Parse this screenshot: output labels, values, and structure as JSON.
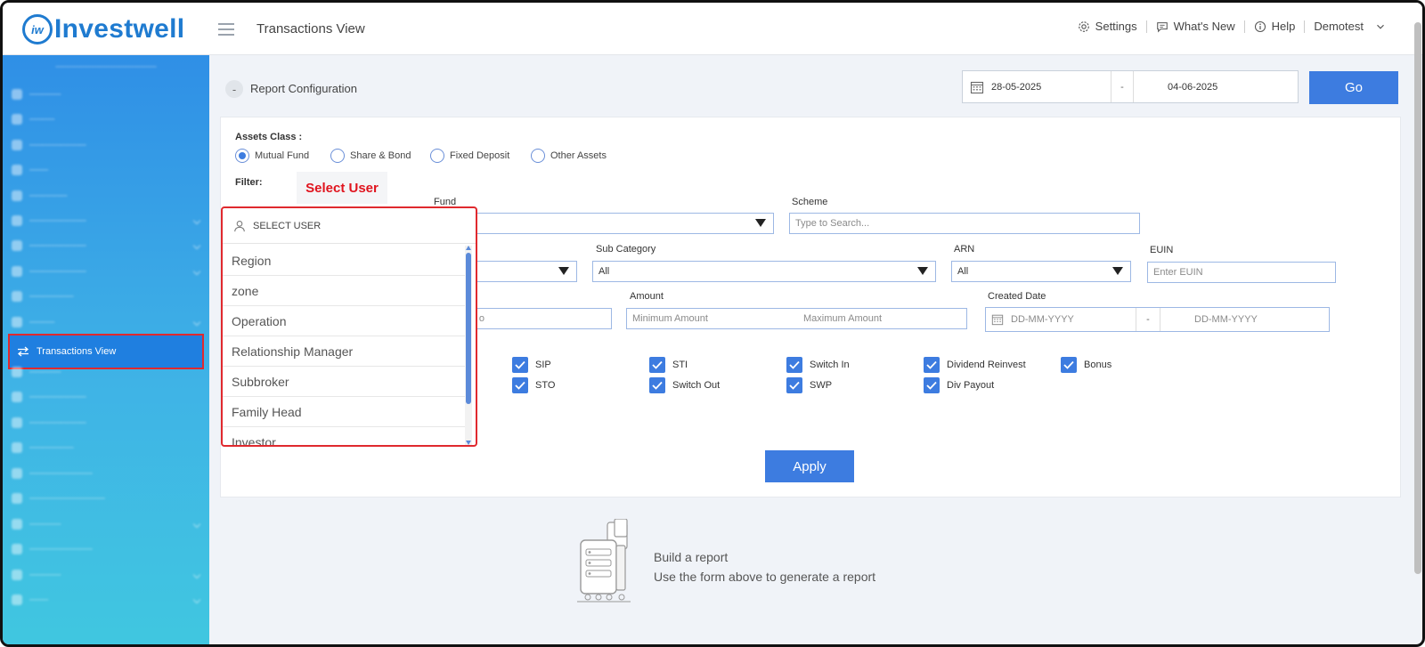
{
  "app": {
    "brand": "Investwell",
    "brand_icon": "iw",
    "page_title": "Transactions View"
  },
  "header": {
    "settings": "Settings",
    "whats_new": "What's New",
    "help": "Help",
    "user": "Demotest"
  },
  "sidebar": {
    "active_item": "Transactions View"
  },
  "report": {
    "config_toggle": "-",
    "config_label": "Report Configuration",
    "date_from": "28-05-2025",
    "date_sep": "-",
    "date_to": "04-06-2025",
    "go": "Go"
  },
  "form": {
    "assets_class_label": "Assets Class :",
    "assets": [
      "Mutual Fund",
      "Share & Bond",
      "Fixed Deposit",
      "Other Assets"
    ],
    "assets_selected": "Mutual Fund",
    "filter_label": "Filter:",
    "select_user_note": "Select User",
    "fund_label": "Fund",
    "scheme_label": "Scheme",
    "scheme_placeholder": "Type to Search...",
    "sub_category_label": "Sub Category",
    "sub_category_value": "All",
    "arn_label": "ARN",
    "arn_value": "All",
    "euin_label": "EUIN",
    "euin_placeholder": "Enter EUIN",
    "amount_label": "Amount",
    "amount_min_placeholder": "Minimum Amount",
    "amount_max_placeholder": "Maximum Amount",
    "created_date_label": "Created Date",
    "created_from_placeholder": "DD-MM-YYYY",
    "created_sep": "-",
    "created_to_placeholder": "DD-MM-YYYY",
    "partial_field_text": "o",
    "transaction_types": {
      "row1": [
        "SIP",
        "STI",
        "Switch In",
        "Dividend Reinvest",
        "Bonus"
      ],
      "row2": [
        "STO",
        "Switch Out",
        "SWP",
        "Div Payout"
      ]
    },
    "apply": "Apply"
  },
  "dropdown": {
    "header": "SELECT USER",
    "items": [
      "Region",
      "zone",
      "Operation",
      "Relationship Manager",
      "Subbroker",
      "Family Head",
      "Investor"
    ]
  },
  "empty_state": {
    "title": "Build a report",
    "subtitle": "Use the form above to generate a report"
  },
  "colors": {
    "accent": "#3d7ce0",
    "brand": "#1f7bd0",
    "highlight": "#e0292e"
  }
}
